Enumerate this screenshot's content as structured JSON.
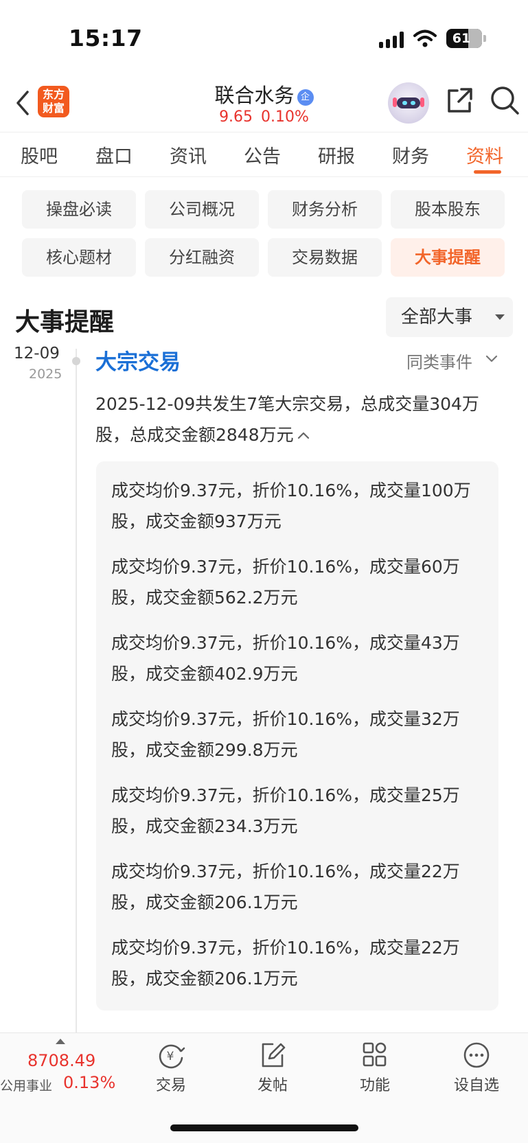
{
  "status_bar": {
    "time": "15:17",
    "battery": "61",
    "battery_level": 0.61,
    "icons": [
      "signal-icon",
      "wifi-icon",
      "battery-icon"
    ]
  },
  "header": {
    "logo_text": [
      "东方",
      "财富"
    ],
    "stock_name": "联合水务",
    "badge_text": "企",
    "price": "9.65",
    "change_pct": "0.10%",
    "icons": [
      "back-icon",
      "assistant-icon",
      "share-icon",
      "search-icon"
    ]
  },
  "colors": {
    "accent": "#f2652a",
    "up": "#e8332d",
    "link": "#1a6fd6"
  },
  "top_tabs": [
    {
      "label": "股吧",
      "active": false
    },
    {
      "label": "盘口",
      "active": false
    },
    {
      "label": "资讯",
      "active": false
    },
    {
      "label": "公告",
      "active": false
    },
    {
      "label": "研报",
      "active": false
    },
    {
      "label": "财务",
      "active": false
    },
    {
      "label": "资料",
      "active": true
    }
  ],
  "sub_tabs": [
    {
      "label": "操盘必读",
      "active": false
    },
    {
      "label": "公司概况",
      "active": false
    },
    {
      "label": "财务分析",
      "active": false
    },
    {
      "label": "股本股东",
      "active": false
    },
    {
      "label": "核心题材",
      "active": false
    },
    {
      "label": "分红融资",
      "active": false
    },
    {
      "label": "交易数据",
      "active": false
    },
    {
      "label": "大事提醒",
      "active": true
    }
  ],
  "section": {
    "title": "大事提醒",
    "filter_label": "全部大事"
  },
  "event": {
    "date": "12-09",
    "year": "2025",
    "title": "大宗交易",
    "same_type_label": "同类事件",
    "summary": "2025-12-09共发生7笔大宗交易，总成交量304万股，总成交金额2848万元",
    "details": [
      "成交均价9.37元，折价10.16%，成交量100万股，成交金额937万元",
      "成交均价9.37元，折价10.16%，成交量60万股，成交金额562.2万元",
      "成交均价9.37元，折价10.16%，成交量43万股，成交金额402.9万元",
      "成交均价9.37元，折价10.16%，成交量32万股，成交金额299.8万元",
      "成交均价9.37元，折价10.16%，成交量25万股，成交金额234.3万元",
      "成交均价9.37元，折价10.16%，成交量22万股，成交金额206.1万元",
      "成交均价9.37元，折价10.16%，成交量22万股，成交金额206.1万元"
    ]
  },
  "bottom_bar": {
    "index_value": "8708.49",
    "index_name": "公用事业",
    "index_change": "0.13%",
    "nav": [
      {
        "label": "交易",
        "icon": "trade-icon"
      },
      {
        "label": "发帖",
        "icon": "edit-icon"
      },
      {
        "label": "功能",
        "icon": "apps-icon"
      },
      {
        "label": "设自选",
        "icon": "more-icon"
      }
    ]
  }
}
